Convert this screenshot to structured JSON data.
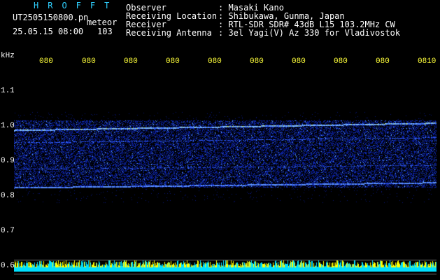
{
  "header": {
    "brand": "HROFFT",
    "file_name": "UT2505150800.pn",
    "file_tag": "meteor",
    "date_time": "25.05.15 08:00",
    "count": "103",
    "fields": [
      {
        "label": "Observer",
        "value": ": Masaki Kano"
      },
      {
        "label": "Receiving Location",
        "value": ": Shibukawa, Gunma, Japan"
      },
      {
        "label": "Receiver",
        "value": ": RTL-SDR SDR# 43dB L15 103.2MHz CW"
      },
      {
        "label": "Receiving Antenna",
        "value": ": 3el Yagi(V) Az 330 for Vladivostok"
      }
    ]
  },
  "axis": {
    "unit": "kHz",
    "y_labels": [
      "1.1",
      "1.0",
      "0.9",
      "0.8",
      "0.7",
      "0.6"
    ],
    "x_labels": [
      "080",
      "080",
      "080",
      "080",
      "080",
      "080",
      "080",
      "080",
      "080",
      "0810"
    ]
  },
  "colors": {
    "background": "#000000",
    "brand": "#2fd0ff",
    "tick_labels": "#ffff3a",
    "noise": "#0a1a8c",
    "signal": "#4a90ff",
    "bottom_bar_cyan": "#00e0ff",
    "bottom_bar_yellow": "#ffff00"
  }
}
